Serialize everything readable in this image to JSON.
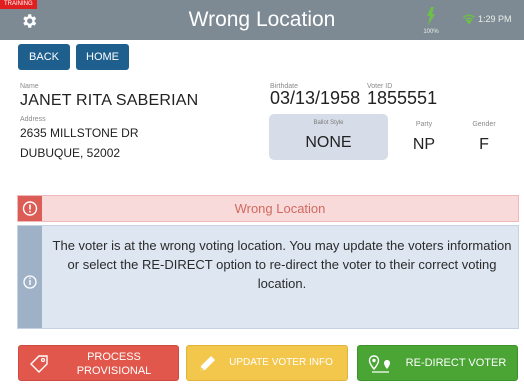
{
  "header": {
    "badge": "TRAINING",
    "title": "Wrong Location",
    "battery_pct": "100%",
    "time": "1:29 PM",
    "icons": [
      "gear-icon",
      "battery-icon",
      "wifi-icon"
    ]
  },
  "nav": {
    "back_label": "BACK",
    "home_label": "HOME"
  },
  "voter": {
    "name_label": "Name",
    "name": "JANET RITA SABERIAN",
    "address_label": "Address",
    "address_line1": "2635 MILLSTONE DR",
    "address_line2": "DUBUQUE, 52002",
    "birthdate_label": "Birthdate",
    "birthdate": "03/13/1958",
    "voter_id_label": "Voter ID",
    "voter_id": "1855551",
    "ballot_style_label": "Ballot Style",
    "ballot_style": "NONE",
    "party_label": "Party",
    "party": "NP",
    "gender_label": "Gender",
    "gender": "F"
  },
  "alert": {
    "title": "Wrong Location",
    "message": "The voter is at the wrong voting location. You may update the voters information or select the RE-DIRECT option to re-direct the voter to their correct voting location."
  },
  "actions": {
    "provisional_label_line1": "PROCESS",
    "provisional_label_line2": "PROVISIONAL",
    "update_label": "UPDATE VOTER INFO",
    "redirect_label": "RE-DIRECT VOTER"
  },
  "colors": {
    "header_bg": "#7d8a93",
    "nav_button": "#1f5f8e",
    "alert_red": "#dc5d55",
    "provisional": "#e2574c",
    "update": "#f3c64c",
    "redirect": "#4aa535"
  }
}
